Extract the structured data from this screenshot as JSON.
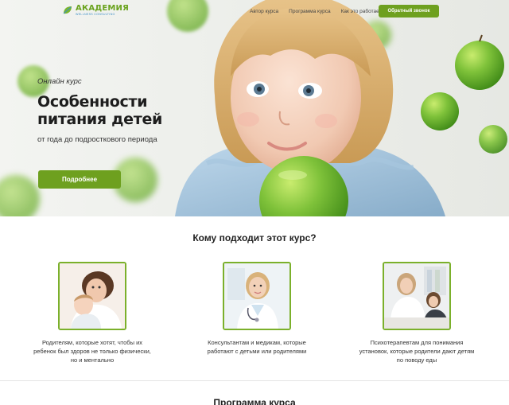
{
  "header": {
    "logo_title": "АКАДЕМИЯ",
    "logo_subtitle": "WELLNESS CONSULTING",
    "nav": [
      "Автор курса",
      "Программа курса",
      "Как это работает"
    ],
    "callback_label": "Обратный звонок"
  },
  "hero": {
    "kicker": "Онлайн курс",
    "title": "Особенности питания детей",
    "description": "от года до подросткового периода",
    "cta_label": "Подробнее"
  },
  "audience": {
    "title": "Кому подходит этот курс?",
    "cards": [
      {
        "image": "mother-and-child-photo",
        "text": "Родителям, которые хотят, чтобы их ребенок был здоров не только физически, но и ментально"
      },
      {
        "image": "doctor-photo",
        "text": "Консультантам и медикам, которые работают с детьми или родителями"
      },
      {
        "image": "psychotherapy-session-photo",
        "text": "Психотерапевтам для понимания установок, которые родители дают детям по поводу еды"
      }
    ]
  },
  "program": {
    "title": "Программа курса"
  },
  "colors": {
    "accent": "#6ea01f",
    "card_border": "#7bb02b",
    "apple": "#7fc23a"
  }
}
